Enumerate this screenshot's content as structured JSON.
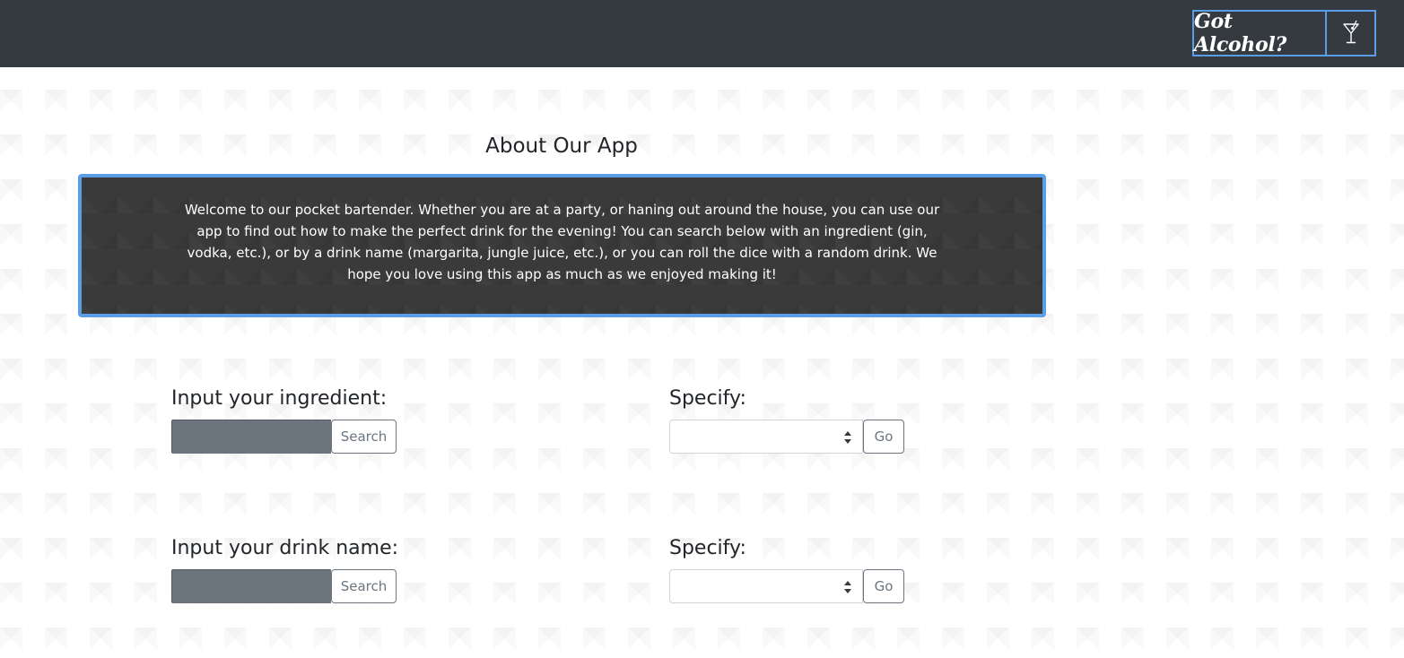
{
  "navbar": {
    "brand_text": "Got Alcohol?",
    "brand_icon": "martini-glass-icon",
    "background_color": "#343a40",
    "accent_color": "#5b9ee8"
  },
  "about": {
    "title": "About Our App",
    "body": "Welcome to our pocket bartender. Whether you are at a party, or haning out around the house, you can use our app to find out how to make the perfect drink for the evening! You can search below with an ingredient (gin, vodka, etc.), or by a drink name (margarita, jungle juice, etc.), or you can roll the dice with a random drink. We hope you love using this app as much as we enjoyed making it!"
  },
  "ingredient_search": {
    "label": "Input your ingredient:",
    "input_value": "",
    "search_label": "Search",
    "specify_label": "Specify:",
    "select_value": "",
    "go_label": "Go"
  },
  "drink_search": {
    "label": "Input your drink name:",
    "input_value": "",
    "search_label": "Search",
    "specify_label": "Specify:",
    "select_value": "",
    "go_label": "Go"
  }
}
